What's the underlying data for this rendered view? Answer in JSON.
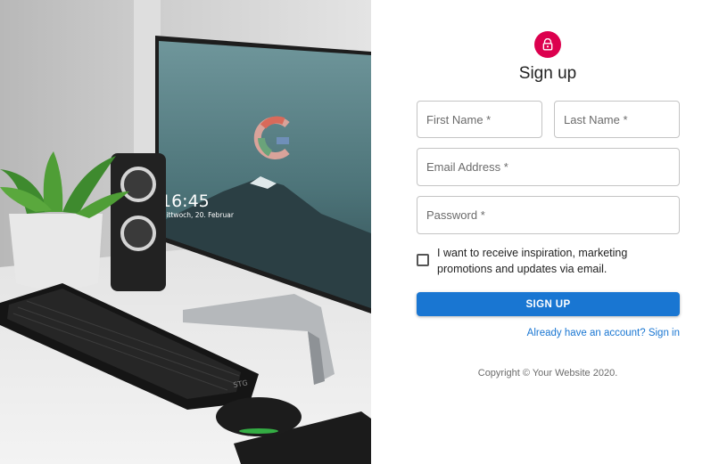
{
  "hero_image": {
    "screen_time": "16:45",
    "screen_date": "Mittwoch, 20. Februar",
    "keyboard_brand": "STG",
    "colors": {
      "desk": "#eeeeee",
      "wall": "#c8c8c8",
      "screen": "#5a8288"
    }
  },
  "form": {
    "lock_icon": "lock-icon",
    "accent_avatar": "#dc004e",
    "title": "Sign up",
    "first_name": {
      "placeholder": "First Name *",
      "value": ""
    },
    "last_name": {
      "placeholder": "Last Name *",
      "value": ""
    },
    "email": {
      "placeholder": "Email Address *",
      "value": ""
    },
    "password": {
      "placeholder": "Password *",
      "value": ""
    },
    "marketing_label": "I want to receive inspiration, marketing promotions and updates via email.",
    "marketing_checked": false,
    "submit_label": "SIGN UP",
    "button_color": "#1976d2",
    "signin_link": "Already have an account? Sign in"
  },
  "footer": {
    "copyright": "Copyright © Your Website 2020."
  }
}
